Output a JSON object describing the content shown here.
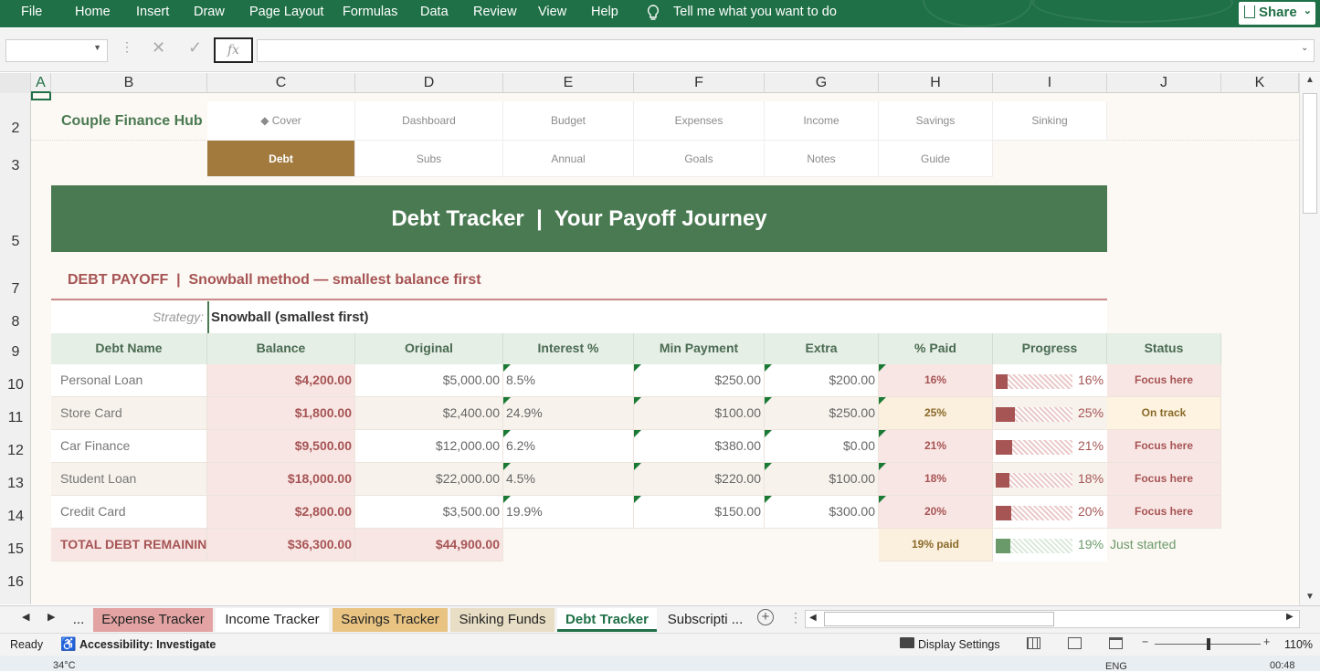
{
  "ribbon": {
    "tabs": [
      "File",
      "Home",
      "Insert",
      "Draw",
      "Page Layout",
      "Formulas",
      "Data",
      "Review",
      "View",
      "Help"
    ],
    "tell_me": "Tell me what you want to do",
    "share": "Share"
  },
  "formula_bar": {
    "fx": "fx",
    "name_box": "",
    "value": ""
  },
  "columns": [
    "A",
    "B",
    "C",
    "D",
    "E",
    "F",
    "G",
    "H",
    "I",
    "J",
    "K"
  ],
  "rows": [
    "2",
    "3",
    "5",
    "7",
    "8",
    "9",
    "10",
    "11",
    "12",
    "13",
    "14",
    "15",
    "16"
  ],
  "brand": "Couple Finance Hub",
  "nav_row1": [
    "◆ Cover",
    "Dashboard",
    "Budget",
    "Expenses",
    "Income",
    "Savings",
    "Sinking"
  ],
  "nav_row2": [
    "Debt",
    "Subs",
    "Annual",
    "Goals",
    "Notes",
    "Guide"
  ],
  "banner": "Debt Tracker  |  Your Payoff Journey",
  "section_title": "DEBT PAYOFF  |  Snowball method — smallest balance first",
  "strategy": {
    "label": "Strategy:",
    "value": "Snowball (smallest first)"
  },
  "table": {
    "headers": [
      "Debt Name",
      "Balance",
      "Original",
      "Interest %",
      "Min Payment",
      "Extra",
      "% Paid",
      "Progress",
      "Status"
    ],
    "rows": [
      {
        "name": "Personal Loan",
        "balance": "$4,200.00",
        "original": "$5,000.00",
        "interest": "8.5%",
        "min": "$250.00",
        "extra": "$200.00",
        "pct": "16%",
        "progress": 0.16,
        "progress_label": "16%",
        "status": "Focus here"
      },
      {
        "name": "Store Card",
        "balance": "$1,800.00",
        "original": "$2,400.00",
        "interest": "24.9%",
        "min": "$100.00",
        "extra": "$250.00",
        "pct": "25%",
        "progress": 0.25,
        "progress_label": "25%",
        "status": "On track"
      },
      {
        "name": "Car Finance",
        "balance": "$9,500.00",
        "original": "$12,000.00",
        "interest": "6.2%",
        "min": "$380.00",
        "extra": "$0.00",
        "pct": "21%",
        "progress": 0.21,
        "progress_label": "21%",
        "status": "Focus here"
      },
      {
        "name": "Student Loan",
        "balance": "$18,000.00",
        "original": "$22,000.00",
        "interest": "4.5%",
        "min": "$220.00",
        "extra": "$100.00",
        "pct": "18%",
        "progress": 0.18,
        "progress_label": "18%",
        "status": "Focus here"
      },
      {
        "name": "Credit Card",
        "balance": "$2,800.00",
        "original": "$3,500.00",
        "interest": "19.9%",
        "min": "$150.00",
        "extra": "$300.00",
        "pct": "20%",
        "progress": 0.2,
        "progress_label": "20%",
        "status": "Focus here"
      }
    ],
    "total": {
      "label": "TOTAL DEBT REMAINING",
      "balance": "$36,300.00",
      "original": "$44,900.00",
      "pct": "19% paid",
      "progress": 0.19,
      "progress_label": "19%",
      "status": "Just started"
    }
  },
  "sheet_tabs": [
    "...",
    "Expense Tracker",
    "Income Tracker",
    "Savings Tracker",
    "Sinking Funds",
    "Debt Tracker",
    "Subscripti ..."
  ],
  "status_bar": {
    "ready": "Ready",
    "accessibility": "Accessibility: Investigate",
    "display": "Display Settings",
    "zoom": "110%"
  },
  "taskbar": {
    "temp": "34°C",
    "lang": "ENG",
    "time": "00:48"
  },
  "colors": {
    "ribbon": "#1f7046",
    "banner": "#4a7a52",
    "accent": "#a27a3e",
    "red": "#a65454",
    "green": "#6a9a6a"
  }
}
